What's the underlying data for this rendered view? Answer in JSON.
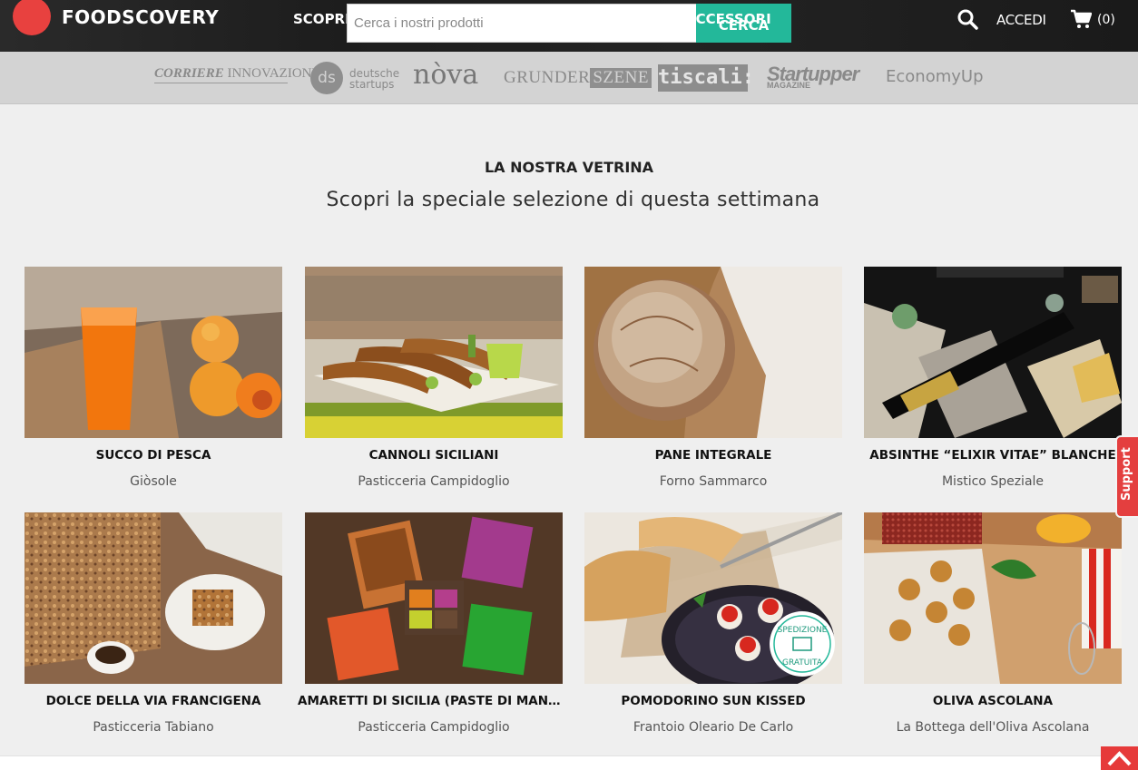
{
  "header": {
    "brand": "FOODSCOVERY",
    "nav_scopri": "SCOPRI",
    "nav_accessori": "ACCESSORI",
    "search_placeholder": "Cerca i nostri prodotti",
    "search_button": "CERCA",
    "login": "ACCEDI",
    "cart_count": "(0)",
    "brand_color": "#e8413f",
    "accent_color": "#23b89a"
  },
  "press": {
    "corriere": "CORRIERE",
    "corriere_sub": "INNOVAZIONE",
    "ds_mark": "ds",
    "ds_line1": "deutsche",
    "ds_line2": "startups",
    "nova": "nòva",
    "grunder": "GRUNDER",
    "szene": "SZENE",
    "tiscali": "tiscali:",
    "startupper": "Startupper",
    "startupper_sub": "MAGAZINE",
    "economy": "EconomyUp"
  },
  "showcase": {
    "kicker": "LA NOSTRA VETRINA",
    "title": "Scopri la speciale selezione di questa settimana"
  },
  "products": [
    {
      "name": "SUCCO DI PESCA",
      "producer": "Giòsole"
    },
    {
      "name": "CANNOLI SICILIANI",
      "producer": "Pasticceria Campidoglio"
    },
    {
      "name": "PANE INTEGRALE",
      "producer": "Forno Sammarco"
    },
    {
      "name": "ABSINTHE “ELIXIR VITAE” BLANCHE",
      "producer": "Mistico Speziale"
    },
    {
      "name": "DOLCE DELLA VIA FRANCIGENA",
      "producer": "Pasticceria Tabiano"
    },
    {
      "name": "AMARETTI DI SICILIA (PASTE DI MANDORLA)",
      "producer": "Pasticceria Campidoglio"
    },
    {
      "name": "POMODORINO SUN KISSED",
      "producer": "Frantoio Oleario De Carlo"
    },
    {
      "name": "OLIVA ASCOLANA",
      "producer": "La Bottega dell'Oliva Ascolana"
    }
  ],
  "badges": {
    "free_shipping_top": "SPEDIZIONE",
    "free_shipping_bottom": "GRATUITA"
  },
  "support": "Support"
}
